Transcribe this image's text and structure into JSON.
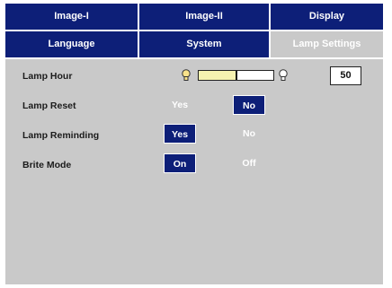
{
  "tabs_row1": [
    {
      "label": "Image-I"
    },
    {
      "label": "Image-II"
    },
    {
      "label": "Display"
    }
  ],
  "tabs_row2": [
    {
      "label": "Language"
    },
    {
      "label": "System"
    },
    {
      "label": "Lamp Settings",
      "active": true
    }
  ],
  "lamp_hour": {
    "label": "Lamp Hour",
    "value": "50",
    "level_fraction": 0.52,
    "bulb_left_icon": "lamp-bulb-icon",
    "bulb_right_icon": "lamp-bulb-icon"
  },
  "lamp_reset": {
    "label": "Lamp Reset",
    "options": [
      "Yes",
      "No"
    ],
    "selected": "No"
  },
  "lamp_reminding": {
    "label": "Lamp Reminding",
    "options": [
      "Yes",
      "No"
    ],
    "selected": "Yes"
  },
  "brite_mode": {
    "label": "Brite Mode",
    "options": [
      "On",
      "Off"
    ],
    "selected": "On"
  },
  "colors": {
    "accent": "#0d1f78",
    "panel": "#c9c9c9",
    "bar_fill": "#f6f2b0"
  }
}
